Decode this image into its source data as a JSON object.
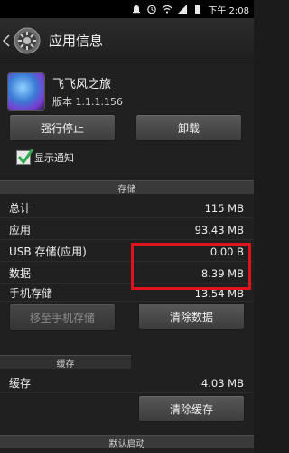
{
  "status_bar": {
    "time": "下午 2:08",
    "icons": [
      "android-debug-icon",
      "alarm-icon",
      "wifi-icon",
      "signal-icon",
      "battery-icon"
    ]
  },
  "action_bar": {
    "title": "应用信息"
  },
  "app": {
    "name": "飞飞风之旅",
    "version": "版本 1.1.1.156"
  },
  "buttons": {
    "force_stop": "强行停止",
    "uninstall": "卸载",
    "move_to_phone": "移至手机存储",
    "clear_data": "清除数据",
    "clear_cache": "清除缓存"
  },
  "checkbox": {
    "label": "显示通知",
    "checked": true
  },
  "sections": {
    "storage": "存储",
    "cache": "缓存",
    "default_launch": "默认启动"
  },
  "storage_rows": [
    {
      "label": "总计",
      "value": "115 MB"
    },
    {
      "label": "应用",
      "value": "93.43 MB"
    },
    {
      "label": "USB 存储(应用)",
      "value": "0.00 B"
    },
    {
      "label": "数据",
      "value": "8.39 MB"
    },
    {
      "label": "手机存储",
      "value": "13.54 MB"
    }
  ],
  "cache_row": {
    "label": "缓存",
    "value": "4.03 MB"
  },
  "colors": {
    "highlight": "#e0131c",
    "check": "#2fa84f"
  }
}
